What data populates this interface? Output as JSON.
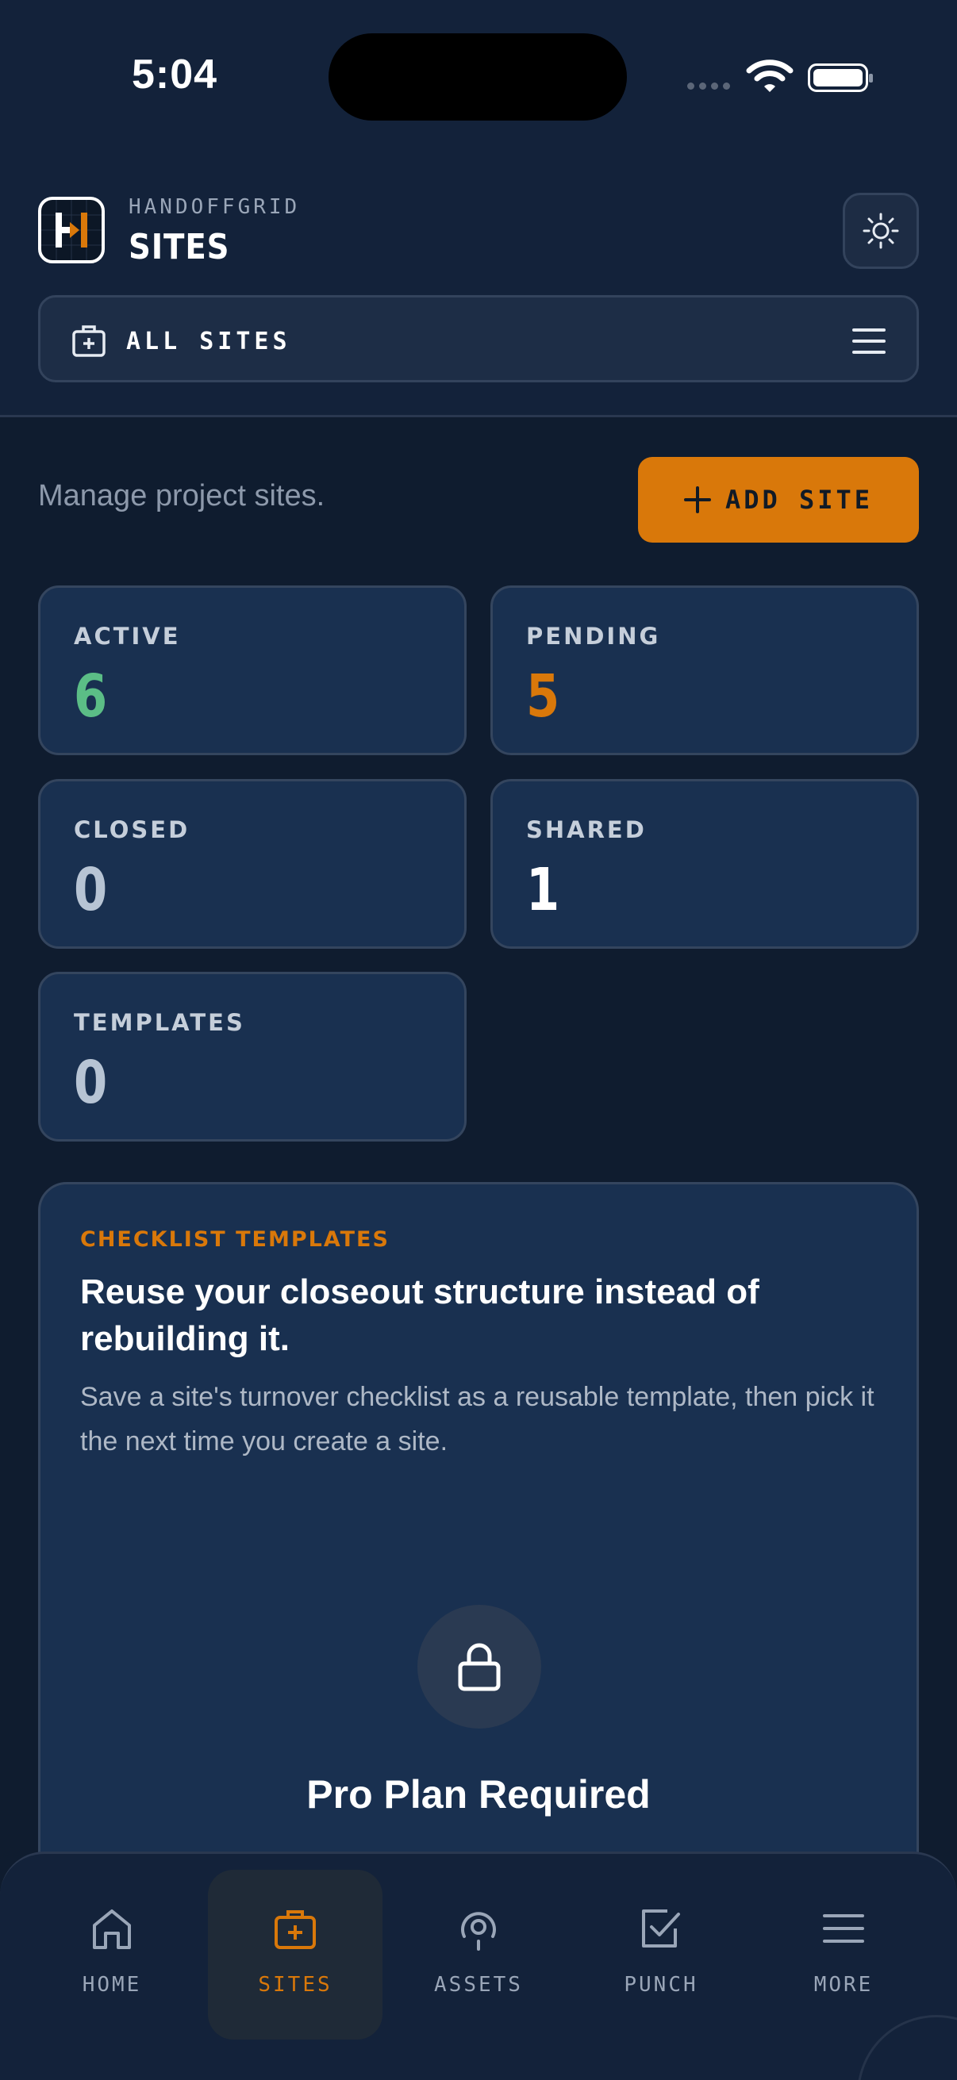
{
  "status_bar": {
    "time": "5:04"
  },
  "header": {
    "brand_sub": "HANDOFFGRID",
    "title": "SITES",
    "theme_icon": "sun-icon",
    "site_selector": {
      "icon": "briefcase-plus-icon",
      "label": "ALL SITES",
      "menu_icon": "hamburger-menu-icon"
    }
  },
  "main": {
    "intro": "Manage project sites.",
    "add_button": {
      "icon": "plus-icon",
      "label": "ADD SITE"
    },
    "stats": [
      {
        "label": "ACTIVE",
        "value": "6",
        "color": "#5bbd86"
      },
      {
        "label": "PENDING",
        "value": "5",
        "color": "#d9780a"
      },
      {
        "label": "CLOSED",
        "value": "0",
        "color": "#b7c4d4"
      },
      {
        "label": "SHARED",
        "value": "1",
        "color": "#ffffff"
      },
      {
        "label": "TEMPLATES",
        "value": "0",
        "color": "#b7c4d4"
      }
    ],
    "promo": {
      "kicker": "CHECKLIST TEMPLATES",
      "headline": "Reuse your closeout structure instead of rebuilding it.",
      "body": "Save a site's turnover checklist as a reusable template, then pick it the next time you create a site.",
      "lock_icon": "lock-icon",
      "locked_title": "Pro Plan Required"
    }
  },
  "tabbar": {
    "tabs": [
      {
        "label": "HOME",
        "icon": "home-icon",
        "active": false
      },
      {
        "label": "SITES",
        "icon": "briefcase-plus-icon",
        "active": true
      },
      {
        "label": "ASSETS",
        "icon": "location-target-icon",
        "active": false
      },
      {
        "label": "PUNCH",
        "icon": "checkbox-icon",
        "active": false
      },
      {
        "label": "MORE",
        "icon": "hamburger-menu-icon",
        "active": false
      }
    ]
  },
  "colors": {
    "accent": "#d9780a",
    "background": "#0f1c2f",
    "card": "#193050"
  }
}
